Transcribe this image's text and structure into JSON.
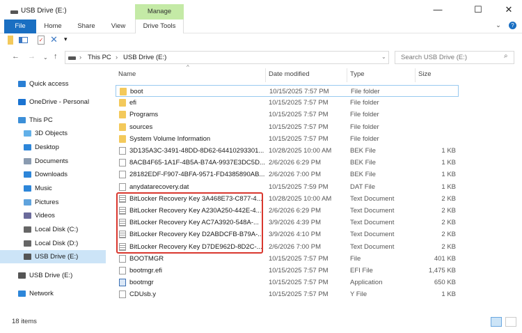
{
  "window": {
    "title": "USB Drive (E:)",
    "context_tab": "Manage",
    "minimize": "—",
    "maximize": "☐",
    "close": "✕"
  },
  "ribbon": {
    "tabs": [
      "File",
      "Home",
      "Share",
      "View",
      "Drive Tools"
    ]
  },
  "address": {
    "crumbs": [
      "This PC",
      "USB Drive (E:)"
    ],
    "search_placeholder": "Search USB Drive (E:)"
  },
  "columns": {
    "name": "Name",
    "date": "Date modified",
    "type": "Type",
    "size": "Size"
  },
  "sidebar": [
    {
      "label": "Quick access",
      "icon": "star-icon",
      "color": "#2a7fd4"
    },
    {
      "label": "OneDrive - Personal",
      "icon": "cloud-icon",
      "color": "#1a73d1"
    },
    {
      "label": "This PC",
      "icon": "computer-icon",
      "color": "#3c8fd8"
    },
    {
      "label": "3D Objects",
      "icon": "cube-icon",
      "color": "#62b0e8"
    },
    {
      "label": "Desktop",
      "icon": "desktop-icon",
      "color": "#2d86d9"
    },
    {
      "label": "Documents",
      "icon": "documents-icon",
      "color": "#8a9bb0"
    },
    {
      "label": "Downloads",
      "icon": "download-icon",
      "color": "#2d86d9"
    },
    {
      "label": "Music",
      "icon": "music-icon",
      "color": "#2d86d9"
    },
    {
      "label": "Pictures",
      "icon": "pictures-icon",
      "color": "#5fa3dd"
    },
    {
      "label": "Videos",
      "icon": "videos-icon",
      "color": "#6b6b9b"
    },
    {
      "label": "Local Disk (C:)",
      "icon": "disk-icon",
      "color": "#666"
    },
    {
      "label": "Local Disk (D:)",
      "icon": "disk-icon",
      "color": "#666"
    },
    {
      "label": "USB Drive (E:)",
      "icon": "usb-drive-icon",
      "color": "#555"
    },
    {
      "label": "USB Drive (E:)",
      "icon": "usb-drive-icon",
      "color": "#555"
    },
    {
      "label": "Network",
      "icon": "network-icon",
      "color": "#2d86d9"
    }
  ],
  "files": [
    {
      "name": "boot",
      "date": "10/15/2025 7:57 PM",
      "type": "File folder",
      "size": "",
      "kind": "folder"
    },
    {
      "name": "efi",
      "date": "10/15/2025 7:57 PM",
      "type": "File folder",
      "size": "",
      "kind": "folder"
    },
    {
      "name": "Programs",
      "date": "10/15/2025 7:57 PM",
      "type": "File folder",
      "size": "",
      "kind": "folder"
    },
    {
      "name": "sources",
      "date": "10/15/2025 7:57 PM",
      "type": "File folder",
      "size": "",
      "kind": "folder"
    },
    {
      "name": "System Volume Information",
      "date": "10/15/2025 7:57 PM",
      "type": "File folder",
      "size": "",
      "kind": "folder"
    },
    {
      "name": "3D135A3C-3491-48DD-8D62-64410293301...",
      "date": "10/28/2025 10:00 AM",
      "type": "BEK File",
      "size": "1 KB",
      "kind": "doc"
    },
    {
      "name": "8ACB4F65-1A1F-4B5A-B74A-9937E3DC5D...",
      "date": "2/6/2026 6:29 PM",
      "type": "BEK File",
      "size": "1 KB",
      "kind": "doc"
    },
    {
      "name": "28182EDF-F907-4BFA-9571-FD4385890AB...",
      "date": "2/6/2026 7:00 PM",
      "type": "BEK File",
      "size": "1 KB",
      "kind": "doc"
    },
    {
      "name": "anydatarecovery.dat",
      "date": "10/15/2025 7:59 PM",
      "type": "DAT File",
      "size": "1 KB",
      "kind": "doc"
    },
    {
      "name": "BitLocker Recovery Key 3A468E73-C877-4...",
      "date": "10/28/2025 10:00 AM",
      "type": "Text Document",
      "size": "2 KB",
      "kind": "txt"
    },
    {
      "name": "BitLocker Recovery Key A230A250-442E-4...",
      "date": "2/6/2026 6:29 PM",
      "type": "Text Document",
      "size": "2 KB",
      "kind": "txt"
    },
    {
      "name": "BitLocker Recovery Key AC7A3920-548A-...",
      "date": "3/9/2026 4:39 PM",
      "type": "Text Document",
      "size": "2 KB",
      "kind": "txt"
    },
    {
      "name": "BitLocker Recovery Key D2ABDCFB-B79A-...",
      "date": "3/9/2026 4:10 PM",
      "type": "Text Document",
      "size": "2 KB",
      "kind": "txt"
    },
    {
      "name": "BitLocker Recovery Key D7DE962D-8D2C-...",
      "date": "2/6/2026 7:00 PM",
      "type": "Text Document",
      "size": "2 KB",
      "kind": "txt"
    },
    {
      "name": "BOOTMGR",
      "date": "10/15/2025 7:57 PM",
      "type": "File",
      "size": "401 KB",
      "kind": "doc"
    },
    {
      "name": "bootmgr.efi",
      "date": "10/15/2025 7:57 PM",
      "type": "EFI File",
      "size": "1,475 KB",
      "kind": "doc"
    },
    {
      "name": "bootmgr",
      "date": "10/15/2025 7:57 PM",
      "type": "Application",
      "size": "650 KB",
      "kind": "app"
    },
    {
      "name": "CDUsb.y",
      "date": "10/15/2025 7:57 PM",
      "type": "Y File",
      "size": "1 KB",
      "kind": "doc"
    }
  ],
  "status": {
    "count": "18 items"
  }
}
